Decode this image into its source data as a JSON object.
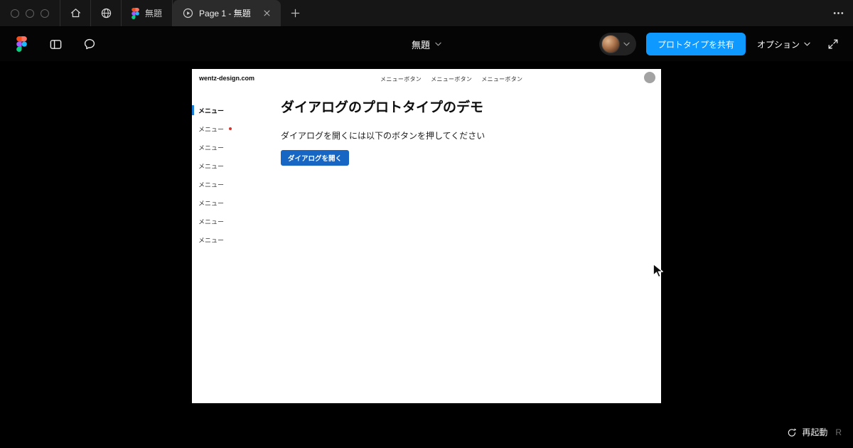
{
  "colors": {
    "accent_blue": "#0d99ff",
    "dialog_button_blue": "#1766c4",
    "active_menu_bar_blue": "#1c7ed6",
    "notification_red": "#d6332a"
  },
  "tab_bar": {
    "inactive_tab_label": "無題",
    "active_tab_label": "Page 1 - 無題"
  },
  "toolbar": {
    "file_title": "無題",
    "share_button_label": "プロトタイプを共有",
    "options_label": "オプション"
  },
  "prototype": {
    "site_name": "wentz-design.com",
    "nav_items": [
      "メニューボタン",
      "メニューボタン",
      "メニューボタン"
    ],
    "sidebar_items": [
      "メニュー",
      "メニュー",
      "メニュー",
      "メニュー",
      "メニュー",
      "メニュー",
      "メニュー",
      "メニュー"
    ],
    "heading": "ダイアログのプロトタイプのデモ",
    "description": "ダイアログを開くには以下のボタンを押してください",
    "open_dialog_button_label": "ダイアログを開く"
  },
  "footer": {
    "restart_label": "再起動",
    "restart_shortcut": "R"
  }
}
